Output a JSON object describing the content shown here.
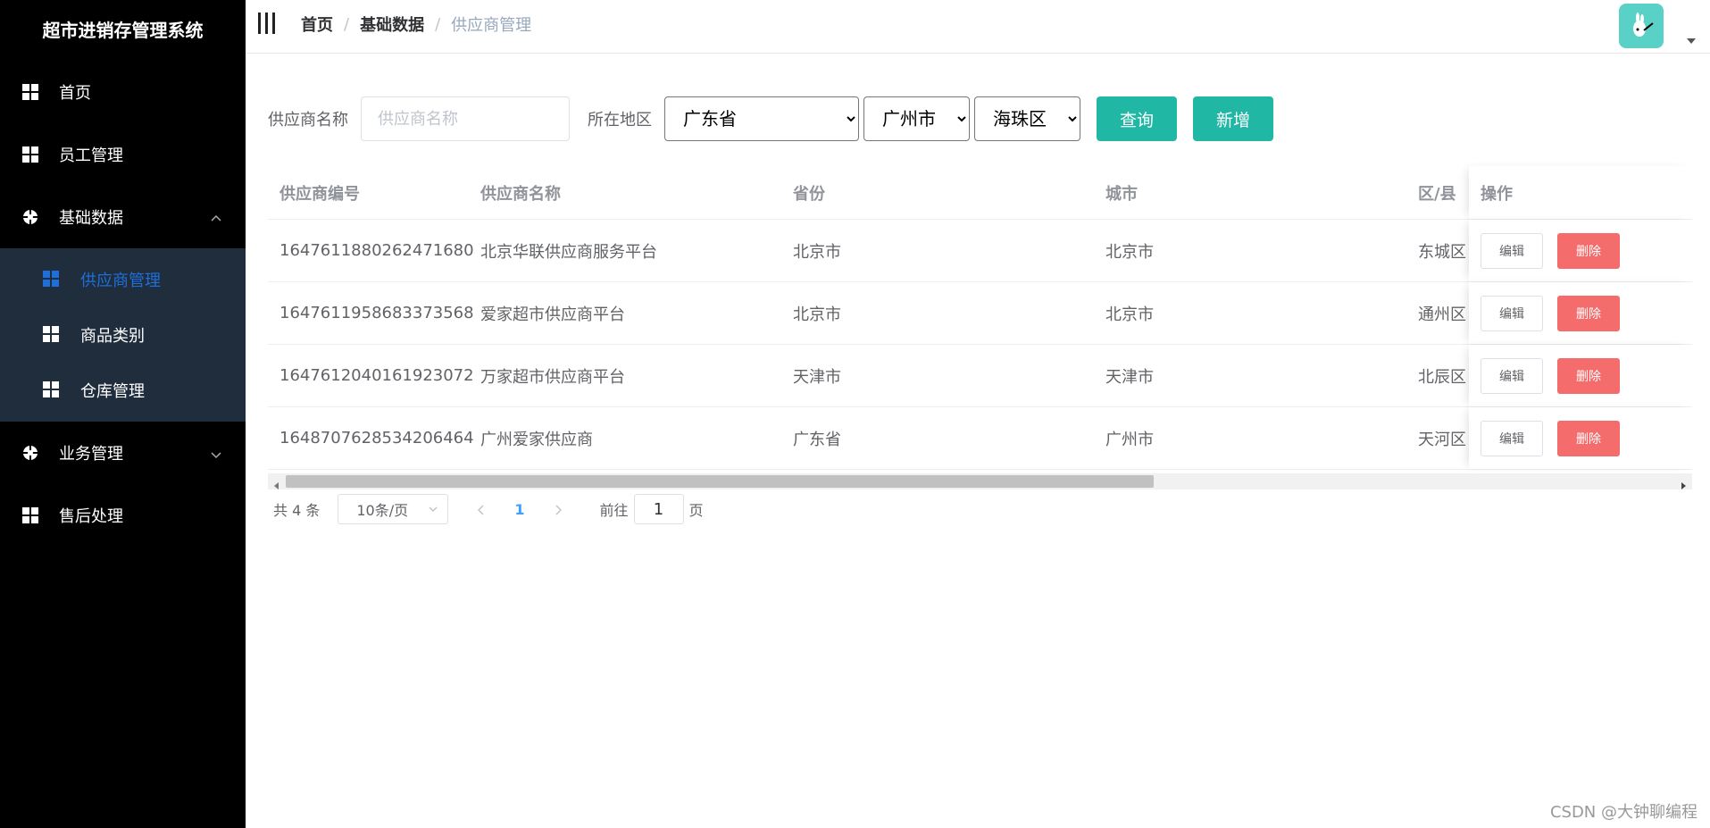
{
  "sidebar": {
    "title": "超市进销存管理系统",
    "items": [
      {
        "label": "首页"
      },
      {
        "label": "员工管理"
      },
      {
        "label": "基础数据"
      },
      {
        "label": "业务管理"
      },
      {
        "label": "售后处理"
      }
    ],
    "subitems": [
      {
        "label": "供应商管理",
        "active": true
      },
      {
        "label": "商品类别"
      },
      {
        "label": "仓库管理"
      }
    ],
    "active_color": "#1e6fd9"
  },
  "header": {
    "breadcrumb": [
      "首页",
      "基础数据",
      "供应商管理"
    ],
    "separator": "/"
  },
  "filters": {
    "name_label": "供应商名称",
    "name_placeholder": "供应商名称",
    "region_label": "所在地区",
    "province": "广东省",
    "city": "广州市",
    "district": "海珠区",
    "query_label": "查询",
    "add_label": "新增"
  },
  "table": {
    "columns": [
      "供应商编号",
      "供应商名称",
      "省份",
      "城市",
      "区/县",
      "操作"
    ],
    "rows": [
      {
        "id": "1647611880262471680",
        "name": "北京华联供应商服务平台",
        "province": "北京市",
        "city": "北京市",
        "district": "东城区"
      },
      {
        "id": "1647611958683373568",
        "name": "爱家超市供应商平台",
        "province": "北京市",
        "city": "北京市",
        "district": "通州区"
      },
      {
        "id": "1647612040161923072",
        "name": "万家超市供应商平台",
        "province": "天津市",
        "city": "天津市",
        "district": "北辰区"
      },
      {
        "id": "1648707628534206464",
        "name": "广州爱家供应商",
        "province": "广东省",
        "city": "广州市",
        "district": "天河区"
      }
    ],
    "edit_label": "编辑",
    "delete_label": "删除"
  },
  "pagination": {
    "total_text": "共 4 条",
    "page_size": "10条/页",
    "current_page": "1",
    "goto_label": "前往",
    "goto_value": "1",
    "page_suffix": "页"
  },
  "watermark": "CSDN @大钟聊编程",
  "colors": {
    "teal": "#20b7a4",
    "danger": "#f56c6c",
    "sidebar_bg": "#000000",
    "submenu_bg": "#1f2d3d"
  }
}
